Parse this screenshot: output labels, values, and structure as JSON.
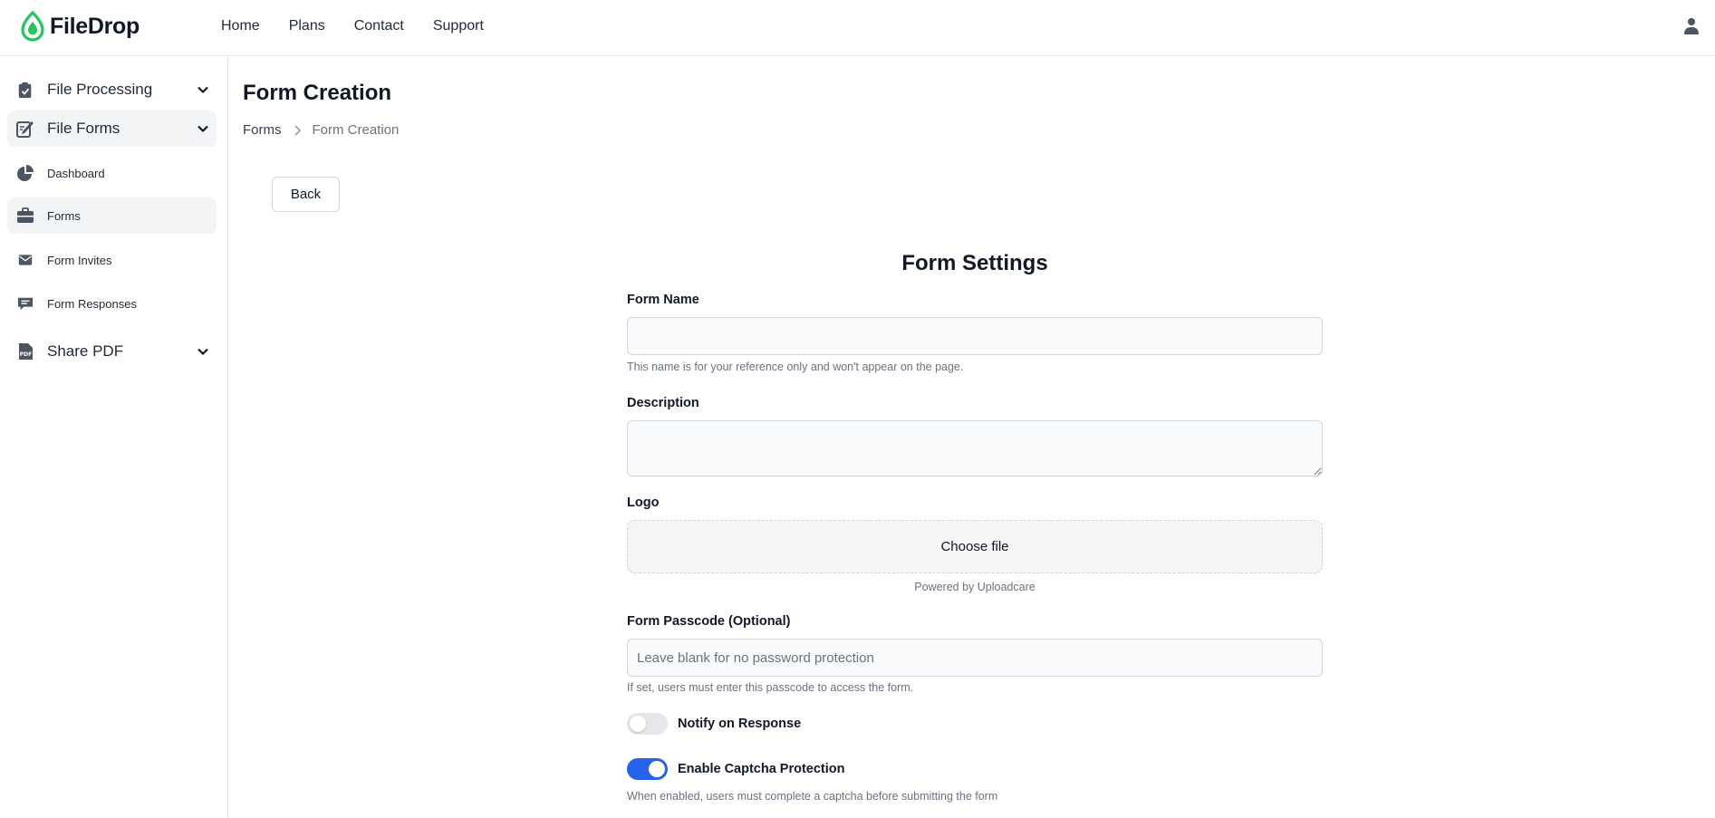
{
  "app": {
    "name": "FileDrop",
    "brand_color": "#22c55e",
    "accent_color": "#2563eb"
  },
  "nav": {
    "items": [
      {
        "label": "Home"
      },
      {
        "label": "Plans"
      },
      {
        "label": "Contact"
      },
      {
        "label": "Support"
      }
    ]
  },
  "sidebar": {
    "groups": [
      {
        "label": "File Processing",
        "icon": "clipboard-check-icon",
        "expanded": false
      },
      {
        "label": "File Forms",
        "icon": "edit-document-icon",
        "expanded": true
      },
      {
        "label": "Share PDF",
        "icon": "pdf-file-icon",
        "expanded": false
      }
    ],
    "items": [
      {
        "label": "Dashboard",
        "icon": "pie-chart-icon"
      },
      {
        "label": "Forms",
        "icon": "briefcase-icon",
        "active": true
      },
      {
        "label": "Form Invites",
        "icon": "envelope-icon"
      },
      {
        "label": "Form Responses",
        "icon": "chat-icon"
      }
    ]
  },
  "page": {
    "title": "Form Creation",
    "breadcrumb": {
      "parent": "Forms",
      "current": "Form Creation"
    },
    "back_label": "Back"
  },
  "form": {
    "heading": "Form Settings",
    "name": {
      "label": "Form Name",
      "value": "",
      "help": "This name is for your reference only and won't appear on the page."
    },
    "description": {
      "label": "Description",
      "value": ""
    },
    "logo": {
      "label": "Logo",
      "button": "Choose file",
      "powered_by": "Powered by Uploadcare"
    },
    "passcode": {
      "label": "Form Passcode (Optional)",
      "placeholder": "Leave blank for no password protection",
      "value": "",
      "help": "If set, users must enter this passcode to access the form."
    },
    "notify": {
      "label": "Notify on Response",
      "enabled": false
    },
    "captcha": {
      "label": "Enable Captcha Protection",
      "enabled": true,
      "help": "When enabled, users must complete a captcha before submitting the form"
    }
  }
}
